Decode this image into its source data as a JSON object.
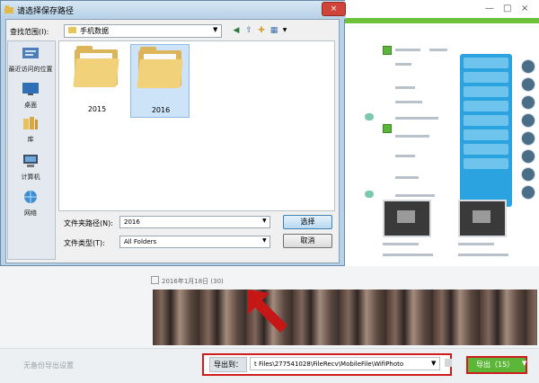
{
  "background_app": {
    "title": "",
    "window_controls": [
      "—",
      "□",
      "×"
    ],
    "date_checkbox_label": "2016年1月18日 (30)",
    "bottom_hint": "无备份导出设置",
    "export_label": "导出到：",
    "export_path": "t Files\\277541028\\FileRecv\\MobileFile\\WifiPhoto",
    "export_button": "导出（15）",
    "accent_green": "#5cb738",
    "highlight_red": "#d01c1c"
  },
  "dialog": {
    "title": "请选择保存路径",
    "close": "×",
    "look_in_label": "查找范围(I):",
    "look_in_value": "手机数据",
    "places": [
      {
        "label": "最近访问的位置",
        "icon": "recent-icon"
      },
      {
        "label": "桌面",
        "icon": "desktop-icon"
      },
      {
        "label": "库",
        "icon": "library-icon"
      },
      {
        "label": "计算机",
        "icon": "computer-icon"
      },
      {
        "label": "网络",
        "icon": "network-icon"
      }
    ],
    "folders": [
      {
        "label": "2015",
        "selected": false
      },
      {
        "label": "2016",
        "selected": true
      }
    ],
    "file_name_label": "文件夹路径(N):",
    "file_name_value": "2016",
    "file_type_label": "文件类型(T):",
    "file_type_value": "All Folders",
    "select_button": "选择",
    "cancel_button": "取消"
  }
}
